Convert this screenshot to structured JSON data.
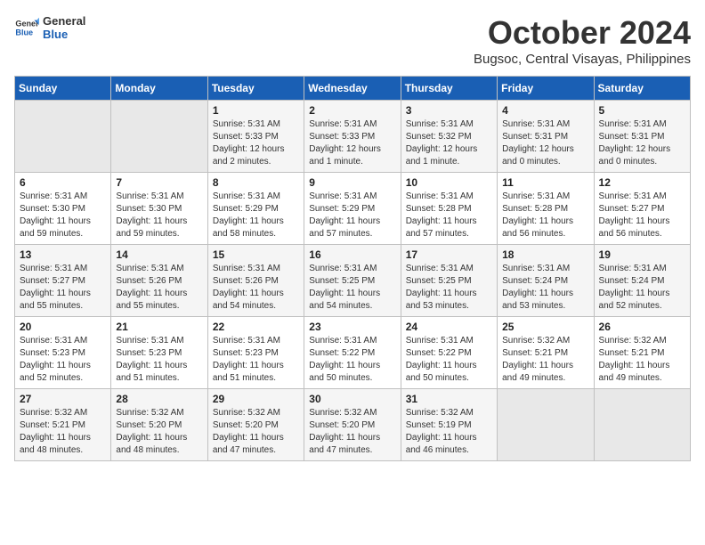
{
  "header": {
    "logo_line1": "General",
    "logo_line2": "Blue",
    "month": "October 2024",
    "location": "Bugsoc, Central Visayas, Philippines"
  },
  "columns": [
    "Sunday",
    "Monday",
    "Tuesday",
    "Wednesday",
    "Thursday",
    "Friday",
    "Saturday"
  ],
  "weeks": [
    [
      {
        "num": "",
        "info": ""
      },
      {
        "num": "",
        "info": ""
      },
      {
        "num": "1",
        "info": "Sunrise: 5:31 AM\nSunset: 5:33 PM\nDaylight: 12 hours\nand 2 minutes."
      },
      {
        "num": "2",
        "info": "Sunrise: 5:31 AM\nSunset: 5:33 PM\nDaylight: 12 hours\nand 1 minute."
      },
      {
        "num": "3",
        "info": "Sunrise: 5:31 AM\nSunset: 5:32 PM\nDaylight: 12 hours\nand 1 minute."
      },
      {
        "num": "4",
        "info": "Sunrise: 5:31 AM\nSunset: 5:31 PM\nDaylight: 12 hours\nand 0 minutes."
      },
      {
        "num": "5",
        "info": "Sunrise: 5:31 AM\nSunset: 5:31 PM\nDaylight: 12 hours\nand 0 minutes."
      }
    ],
    [
      {
        "num": "6",
        "info": "Sunrise: 5:31 AM\nSunset: 5:30 PM\nDaylight: 11 hours\nand 59 minutes."
      },
      {
        "num": "7",
        "info": "Sunrise: 5:31 AM\nSunset: 5:30 PM\nDaylight: 11 hours\nand 59 minutes."
      },
      {
        "num": "8",
        "info": "Sunrise: 5:31 AM\nSunset: 5:29 PM\nDaylight: 11 hours\nand 58 minutes."
      },
      {
        "num": "9",
        "info": "Sunrise: 5:31 AM\nSunset: 5:29 PM\nDaylight: 11 hours\nand 57 minutes."
      },
      {
        "num": "10",
        "info": "Sunrise: 5:31 AM\nSunset: 5:28 PM\nDaylight: 11 hours\nand 57 minutes."
      },
      {
        "num": "11",
        "info": "Sunrise: 5:31 AM\nSunset: 5:28 PM\nDaylight: 11 hours\nand 56 minutes."
      },
      {
        "num": "12",
        "info": "Sunrise: 5:31 AM\nSunset: 5:27 PM\nDaylight: 11 hours\nand 56 minutes."
      }
    ],
    [
      {
        "num": "13",
        "info": "Sunrise: 5:31 AM\nSunset: 5:27 PM\nDaylight: 11 hours\nand 55 minutes."
      },
      {
        "num": "14",
        "info": "Sunrise: 5:31 AM\nSunset: 5:26 PM\nDaylight: 11 hours\nand 55 minutes."
      },
      {
        "num": "15",
        "info": "Sunrise: 5:31 AM\nSunset: 5:26 PM\nDaylight: 11 hours\nand 54 minutes."
      },
      {
        "num": "16",
        "info": "Sunrise: 5:31 AM\nSunset: 5:25 PM\nDaylight: 11 hours\nand 54 minutes."
      },
      {
        "num": "17",
        "info": "Sunrise: 5:31 AM\nSunset: 5:25 PM\nDaylight: 11 hours\nand 53 minutes."
      },
      {
        "num": "18",
        "info": "Sunrise: 5:31 AM\nSunset: 5:24 PM\nDaylight: 11 hours\nand 53 minutes."
      },
      {
        "num": "19",
        "info": "Sunrise: 5:31 AM\nSunset: 5:24 PM\nDaylight: 11 hours\nand 52 minutes."
      }
    ],
    [
      {
        "num": "20",
        "info": "Sunrise: 5:31 AM\nSunset: 5:23 PM\nDaylight: 11 hours\nand 52 minutes."
      },
      {
        "num": "21",
        "info": "Sunrise: 5:31 AM\nSunset: 5:23 PM\nDaylight: 11 hours\nand 51 minutes."
      },
      {
        "num": "22",
        "info": "Sunrise: 5:31 AM\nSunset: 5:23 PM\nDaylight: 11 hours\nand 51 minutes."
      },
      {
        "num": "23",
        "info": "Sunrise: 5:31 AM\nSunset: 5:22 PM\nDaylight: 11 hours\nand 50 minutes."
      },
      {
        "num": "24",
        "info": "Sunrise: 5:31 AM\nSunset: 5:22 PM\nDaylight: 11 hours\nand 50 minutes."
      },
      {
        "num": "25",
        "info": "Sunrise: 5:32 AM\nSunset: 5:21 PM\nDaylight: 11 hours\nand 49 minutes."
      },
      {
        "num": "26",
        "info": "Sunrise: 5:32 AM\nSunset: 5:21 PM\nDaylight: 11 hours\nand 49 minutes."
      }
    ],
    [
      {
        "num": "27",
        "info": "Sunrise: 5:32 AM\nSunset: 5:21 PM\nDaylight: 11 hours\nand 48 minutes."
      },
      {
        "num": "28",
        "info": "Sunrise: 5:32 AM\nSunset: 5:20 PM\nDaylight: 11 hours\nand 48 minutes."
      },
      {
        "num": "29",
        "info": "Sunrise: 5:32 AM\nSunset: 5:20 PM\nDaylight: 11 hours\nand 47 minutes."
      },
      {
        "num": "30",
        "info": "Sunrise: 5:32 AM\nSunset: 5:20 PM\nDaylight: 11 hours\nand 47 minutes."
      },
      {
        "num": "31",
        "info": "Sunrise: 5:32 AM\nSunset: 5:19 PM\nDaylight: 11 hours\nand 46 minutes."
      },
      {
        "num": "",
        "info": ""
      },
      {
        "num": "",
        "info": ""
      }
    ]
  ]
}
